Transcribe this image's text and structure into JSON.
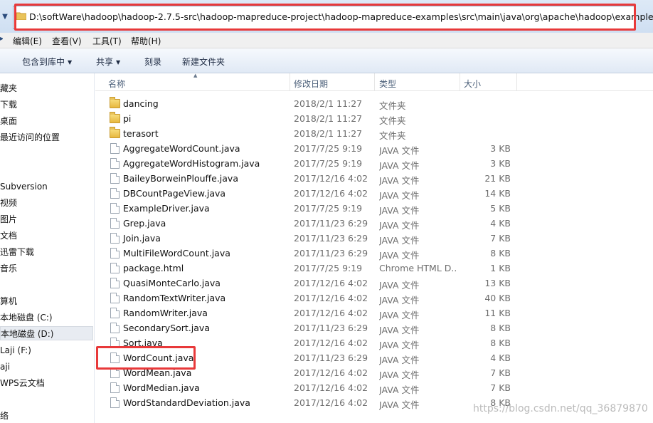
{
  "address": {
    "path": "D:\\softWare\\hadoop\\hadoop-2.7.5-src\\hadoop-mapreduce-project\\hadoop-mapreduce-examples\\src\\main\\java\\org\\apache\\hadoop\\examples"
  },
  "menu": {
    "items": [
      "编辑(E)",
      "查看(V)",
      "工具(T)",
      "帮助(H)"
    ]
  },
  "toolbar": {
    "include_label": "包含到库中",
    "share_label": "共享",
    "burn_label": "刻录",
    "new_folder_label": "新建文件夹"
  },
  "nav": {
    "items": [
      "藏夹",
      "下载",
      "桌面",
      "最近访问的位置",
      "Subversion",
      "视频",
      "图片",
      "文档",
      "迅雷下载",
      "音乐",
      "算机",
      "本地磁盘 (C:)",
      "本地磁盘 (D:)",
      "Laji (F:)",
      "aji",
      "WPS云文档",
      "络"
    ],
    "selected": "本地磁盘 (D:)"
  },
  "columns": {
    "name": "名称",
    "date": "修改日期",
    "type": "类型",
    "size": "大小"
  },
  "files": [
    {
      "name": "dancing",
      "date": "2018/2/1 11:27",
      "type": "文件夹",
      "size": "",
      "kind": "folder"
    },
    {
      "name": "pi",
      "date": "2018/2/1 11:27",
      "type": "文件夹",
      "size": "",
      "kind": "folder"
    },
    {
      "name": "terasort",
      "date": "2018/2/1 11:27",
      "type": "文件夹",
      "size": "",
      "kind": "folder"
    },
    {
      "name": "AggregateWordCount.java",
      "date": "2017/7/25 9:19",
      "type": "JAVA 文件",
      "size": "3 KB",
      "kind": "file"
    },
    {
      "name": "AggregateWordHistogram.java",
      "date": "2017/7/25 9:19",
      "type": "JAVA 文件",
      "size": "3 KB",
      "kind": "file"
    },
    {
      "name": "BaileyBorweinPlouffe.java",
      "date": "2017/12/16 4:02",
      "type": "JAVA 文件",
      "size": "21 KB",
      "kind": "file"
    },
    {
      "name": "DBCountPageView.java",
      "date": "2017/12/16 4:02",
      "type": "JAVA 文件",
      "size": "14 KB",
      "kind": "file"
    },
    {
      "name": "ExampleDriver.java",
      "date": "2017/7/25 9:19",
      "type": "JAVA 文件",
      "size": "5 KB",
      "kind": "file"
    },
    {
      "name": "Grep.java",
      "date": "2017/11/23 6:29",
      "type": "JAVA 文件",
      "size": "4 KB",
      "kind": "file"
    },
    {
      "name": "Join.java",
      "date": "2017/11/23 6:29",
      "type": "JAVA 文件",
      "size": "7 KB",
      "kind": "file"
    },
    {
      "name": "MultiFileWordCount.java",
      "date": "2017/11/23 6:29",
      "type": "JAVA 文件",
      "size": "8 KB",
      "kind": "file"
    },
    {
      "name": "package.html",
      "date": "2017/7/25 9:19",
      "type": "Chrome HTML D...",
      "size": "1 KB",
      "kind": "file"
    },
    {
      "name": "QuasiMonteCarlo.java",
      "date": "2017/12/16 4:02",
      "type": "JAVA 文件",
      "size": "13 KB",
      "kind": "file"
    },
    {
      "name": "RandomTextWriter.java",
      "date": "2017/12/16 4:02",
      "type": "JAVA 文件",
      "size": "40 KB",
      "kind": "file"
    },
    {
      "name": "RandomWriter.java",
      "date": "2017/12/16 4:02",
      "type": "JAVA 文件",
      "size": "11 KB",
      "kind": "file"
    },
    {
      "name": "SecondarySort.java",
      "date": "2017/11/23 6:29",
      "type": "JAVA 文件",
      "size": "8 KB",
      "kind": "file"
    },
    {
      "name": "Sort.java",
      "date": "2017/12/16 4:02",
      "type": "JAVA 文件",
      "size": "8 KB",
      "kind": "file"
    },
    {
      "name": "WordCount.java",
      "date": "2017/11/23 6:29",
      "type": "JAVA 文件",
      "size": "4 KB",
      "kind": "file"
    },
    {
      "name": "WordMean.java",
      "date": "2017/12/16 4:02",
      "type": "JAVA 文件",
      "size": "7 KB",
      "kind": "file"
    },
    {
      "name": "WordMedian.java",
      "date": "2017/12/16 4:02",
      "type": "JAVA 文件",
      "size": "7 KB",
      "kind": "file"
    },
    {
      "name": "WordStandardDeviation.java",
      "date": "2017/12/16 4:02",
      "type": "JAVA 文件",
      "size": "8 KB",
      "kind": "file"
    }
  ],
  "watermark": "https://blog.csdn.net/qq_36879870",
  "colors": {
    "highlight": "#e8393a",
    "folder": "#e7b83f"
  }
}
